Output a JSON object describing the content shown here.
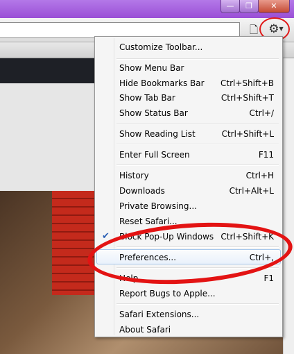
{
  "window": {
    "minimize_glyph": "—",
    "restore_glyph": "❐",
    "close_glyph": "✕"
  },
  "toolbar": {
    "page_icon": "page-icon",
    "gear_icon": "gear-icon",
    "page_glyph": "🗋",
    "gear_glyph": "⚙",
    "chevron_glyph": "▼"
  },
  "menu": {
    "items": [
      {
        "label": "Customize Toolbar...",
        "shortcut": ""
      },
      {
        "label": "Show Menu Bar",
        "shortcut": ""
      },
      {
        "label": "Hide Bookmarks Bar",
        "shortcut": "Ctrl+Shift+B"
      },
      {
        "label": "Show Tab Bar",
        "shortcut": "Ctrl+Shift+T"
      },
      {
        "label": "Show Status Bar",
        "shortcut": "Ctrl+/"
      },
      {
        "label": "Show Reading List",
        "shortcut": "Ctrl+Shift+L"
      },
      {
        "label": "Enter Full Screen",
        "shortcut": "F11"
      },
      {
        "label": "History",
        "shortcut": "Ctrl+H"
      },
      {
        "label": "Downloads",
        "shortcut": "Ctrl+Alt+L"
      },
      {
        "label": "Private Browsing...",
        "shortcut": ""
      },
      {
        "label": "Reset Safari...",
        "shortcut": ""
      },
      {
        "label": "Block Pop-Up Windows",
        "shortcut": "Ctrl+Shift+K",
        "checked": true
      },
      {
        "label": "Preferences...",
        "shortcut": "Ctrl+,",
        "highlighted": true
      },
      {
        "label": "Help",
        "shortcut": "F1"
      },
      {
        "label": "Report Bugs to Apple...",
        "shortcut": ""
      },
      {
        "label": "Safari Extensions...",
        "shortcut": ""
      },
      {
        "label": "About Safari",
        "shortcut": ""
      }
    ],
    "check_glyph": "✔"
  },
  "colors": {
    "annotation": "#e31313",
    "highlight_border": "#a8c8eb",
    "check": "#2b5fb4"
  }
}
